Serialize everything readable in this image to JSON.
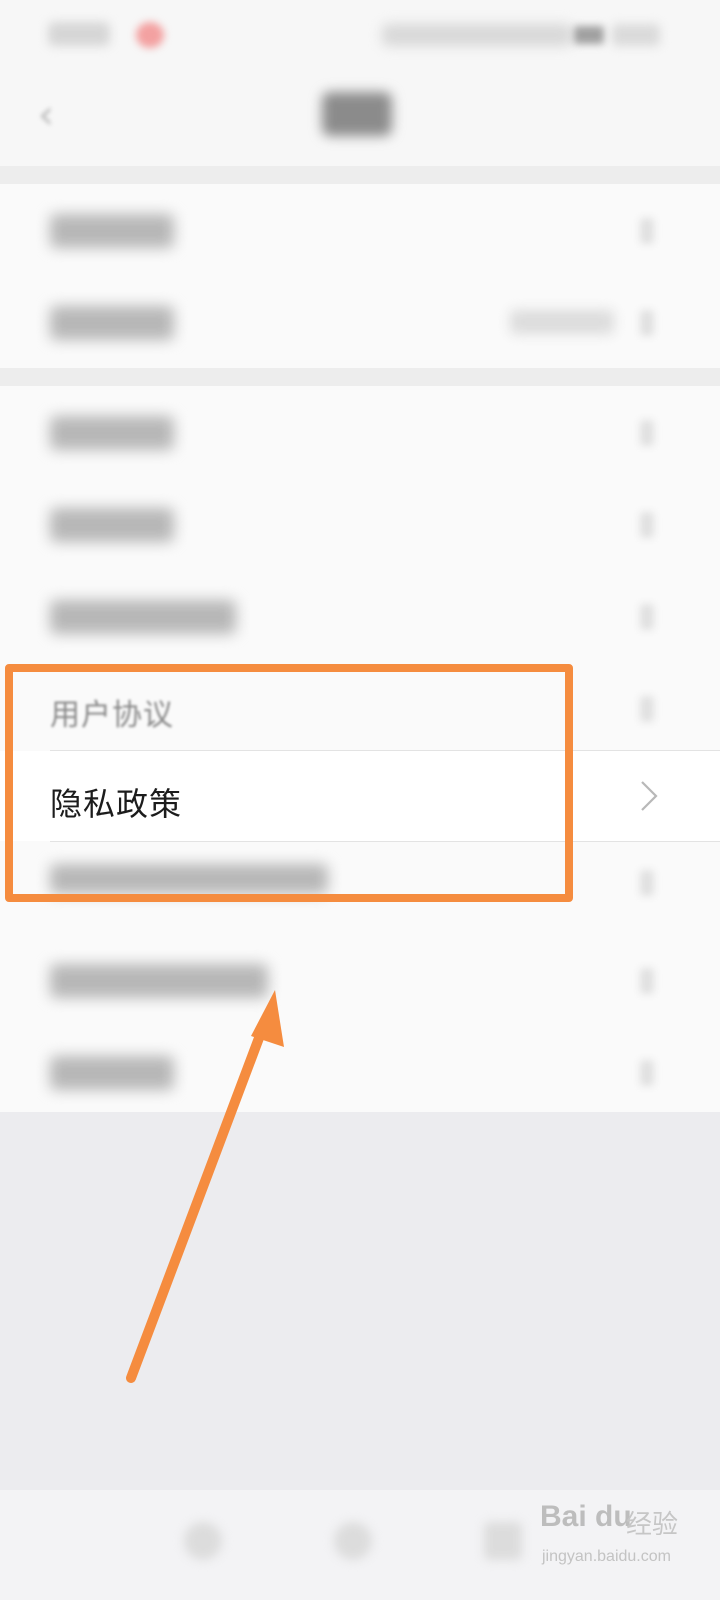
{
  "settings_list": {
    "privacy_policy": {
      "label": "隐私政策"
    },
    "user_agreement_partial": {
      "label": "用户协议"
    }
  },
  "annotation": {
    "highlight_color": "#f58c3f",
    "arrow_color": "#f58c3f"
  },
  "watermark": {
    "brand": "Bai du",
    "product": "经验",
    "url": "jingyan.baidu.com"
  },
  "icons": {
    "back": "chevron-left-icon",
    "row_arrow": "chevron-right-icon"
  }
}
